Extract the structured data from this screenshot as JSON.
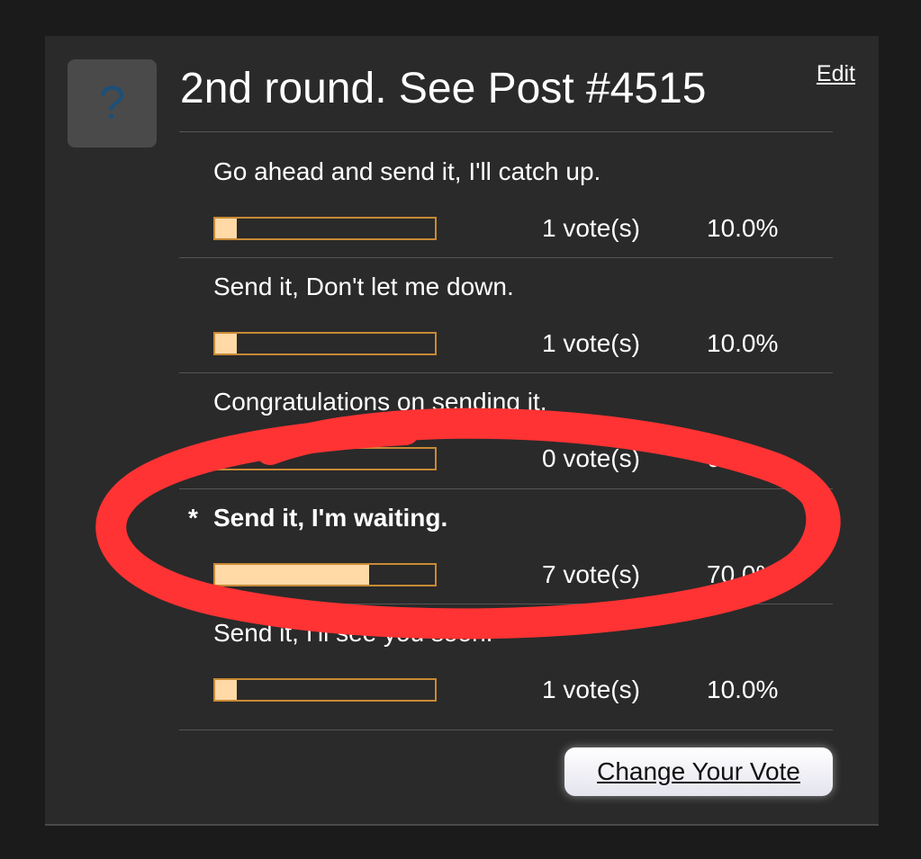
{
  "poll": {
    "icon_glyph": "?",
    "title": "2nd round. See Post #4515",
    "edit_label": "Edit",
    "accent_bar_border": "#c78a35",
    "accent_bar_fill": "#ffd9a6",
    "options": [
      {
        "label": "Go ahead and send it, I'll catch up.",
        "votes": "1 vote(s)",
        "percent": "10.0%",
        "fraction": 0.1,
        "selected": false
      },
      {
        "label": "Send it, Don't let me down.",
        "votes": "1 vote(s)",
        "percent": "10.0%",
        "fraction": 0.1,
        "selected": false
      },
      {
        "label": "Congratulations on sending it.",
        "votes": "0 vote(s)",
        "percent": "0.0%",
        "fraction": 0.0,
        "selected": false
      },
      {
        "label": "Send it, I'm waiting.",
        "votes": "7 vote(s)",
        "percent": "70.0%",
        "fraction": 0.7,
        "selected": true,
        "marker": "*"
      },
      {
        "label": "Send it, I'll see you soon.",
        "votes": "1 vote(s)",
        "percent": "10.0%",
        "fraction": 0.1,
        "selected": false
      }
    ],
    "change_vote_label": "Change Your Vote"
  },
  "annotation": {
    "color": "#ff3333",
    "shape": "hand-drawn-ellipse"
  }
}
